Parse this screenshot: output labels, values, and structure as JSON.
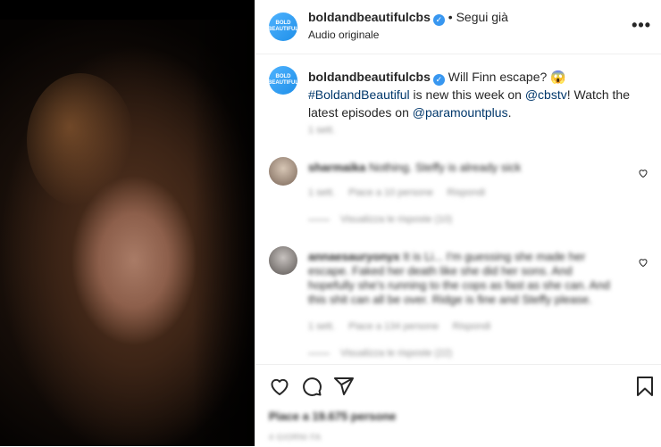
{
  "header": {
    "avatar_text_line1": "BOLD",
    "avatar_text_line2": "BEAUTIFUL",
    "username": "boldandbeautifulcbs",
    "follow_label": "Segui già",
    "separator": "•",
    "subtitle": "Audio originale",
    "more_label": "•••"
  },
  "caption": {
    "username": "boldandbeautifulcbs",
    "text_before": "Will Finn escape? 😱 ",
    "hashtag": "#BoldandBeautiful",
    "text_mid": " is new this week on ",
    "mention1": "@cbstv",
    "text_mid2": "! Watch the latest episodes on ",
    "mention2": "@paramountplus",
    "text_end": ".",
    "time": "1 sett."
  },
  "comments": [
    {
      "username": "sharmaika",
      "text": "Nothing. Steffy is already sick",
      "time": "1 sett.",
      "likes": "Piace a 10 persone",
      "reply": "Rispondi",
      "view_replies": "Visualizza le risposte (10)"
    },
    {
      "username": "annaesauryonyx",
      "text": "It is Li... I'm guessing she made her escape. Faked her death like she did her sons. And hopefully she's running to the cops as fast as she can. And this shit can all be over. Ridge is fine and Steffy please.",
      "time": "1 sett.",
      "likes": "Piace a 134 persone",
      "reply": "Rispondi",
      "view_replies": "Visualizza le risposte (22)"
    }
  ],
  "footer": {
    "likes": "Piace a 19.675 persone",
    "date": "4 GIORNI FA"
  },
  "colors": {
    "accent": "#3897f0",
    "link": "#00376b",
    "avatar_blue": "#1f8fe8"
  },
  "icons": [
    "heart-icon",
    "comment-icon",
    "share-icon",
    "bookmark-icon",
    "verified-icon",
    "more-icon"
  ]
}
